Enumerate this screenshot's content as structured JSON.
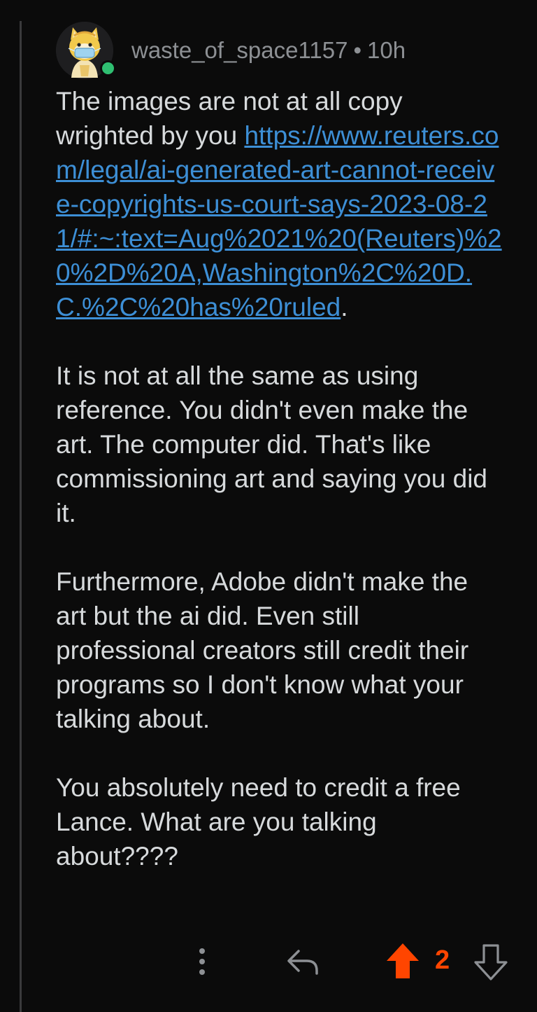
{
  "comment": {
    "author": "waste_of_space1157",
    "separator": "•",
    "age": "10h",
    "online": true,
    "avatar_icon": "shiba-avatar-icon",
    "paragraph1_text": "The images are not at all copy wrighted by you ",
    "paragraph1_link": "https://www.reuters.com/legal/ai-generated-art-cannot-receive-copyrights-us-court-says-2023-08-21/#:~:text=Aug%2021%20(Reuters)%20%2D%20A,Washington%2C%20D.C.%2C%20has%20ruled",
    "paragraph1_end": ".",
    "paragraph2": "It is not at all the same as using reference. You didn't even make the art. The computer did. That's like commissioning art and saying you did it.",
    "paragraph3": "Furthermore, Adobe didn't make the art but the ai did. Even still professional creators still credit their programs so I don't know what your talking about.",
    "paragraph4": "You absolutely need to credit a free Lance. What are you talking about????"
  },
  "actions": {
    "more_icon": "more-vertical-icon",
    "reply_icon": "reply-arrow-icon",
    "upvote_icon": "upvote-arrow-icon",
    "downvote_icon": "downvote-arrow-icon",
    "upvoted": true,
    "vote_count": "2"
  },
  "colors": {
    "background": "#0b0b0b",
    "text": "#d7dadc",
    "meta": "#8d9094",
    "link": "#3d8fd6",
    "upvote": "#ff4500",
    "online": "#2fbf71",
    "thread_line": "#3a3a3c"
  }
}
